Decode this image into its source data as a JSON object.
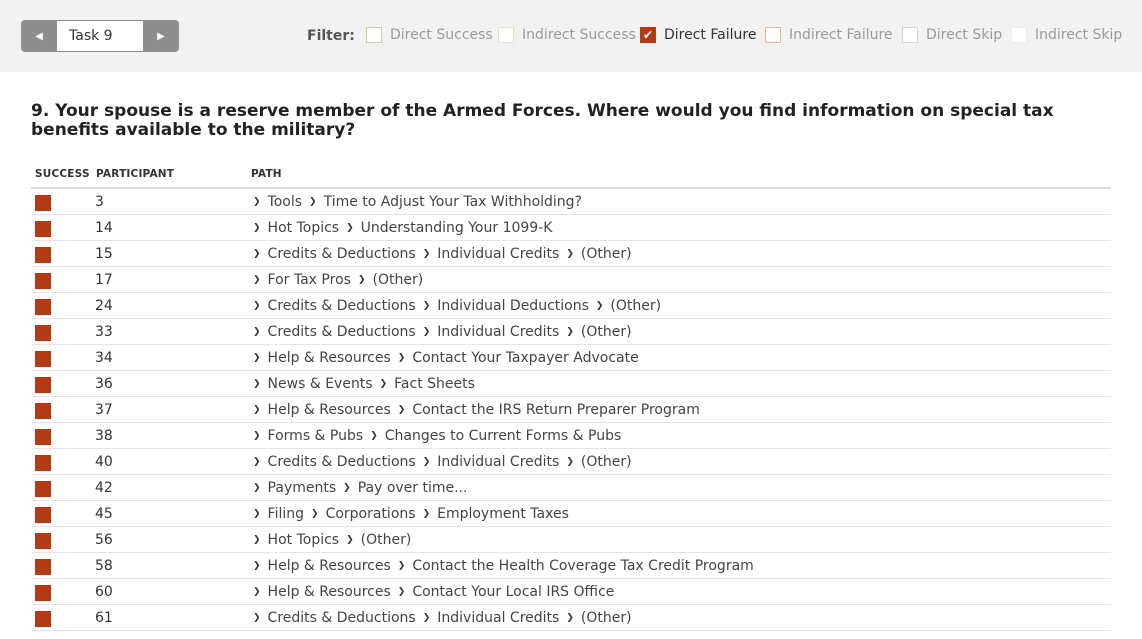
{
  "nav": {
    "task_label": "Task 9",
    "prev_icon": "chevron-left-icon",
    "next_icon": "chevron-right-icon"
  },
  "filter": {
    "label": "Filter:",
    "options": [
      {
        "label": "Direct Success",
        "checked": false,
        "color": "#c9d49a"
      },
      {
        "label": "Indirect Success",
        "checked": false,
        "color": "#e5e5b8"
      },
      {
        "label": "Direct Failure",
        "checked": true,
        "color": "#b33a12"
      },
      {
        "label": "Indirect Failure",
        "checked": false,
        "color": "#e8b79a"
      },
      {
        "label": "Direct Skip",
        "checked": false,
        "color": "#d6d6d6"
      },
      {
        "label": "Indirect Skip",
        "checked": false,
        "color": "#ececec"
      }
    ]
  },
  "question": "9. Your spouse is a reserve member of the Armed Forces. Where would you find information on special tax benefits available to the military?",
  "table": {
    "headers": {
      "success": "SUCCESS",
      "participant": "PARTICIPANT",
      "path": "PATH"
    },
    "status_color": "#b33a12",
    "rows": [
      {
        "participant": "3",
        "path": [
          "Tools",
          "Time to Adjust Your Tax Withholding?"
        ]
      },
      {
        "participant": "14",
        "path": [
          "Hot Topics",
          "Understanding Your 1099-K"
        ]
      },
      {
        "participant": "15",
        "path": [
          "Credits & Deductions",
          "Individual Credits",
          "(Other)"
        ]
      },
      {
        "participant": "17",
        "path": [
          "For Tax Pros",
          "(Other)"
        ]
      },
      {
        "participant": "24",
        "path": [
          "Credits & Deductions",
          "Individual Deductions",
          "(Other)"
        ]
      },
      {
        "participant": "33",
        "path": [
          "Credits & Deductions",
          "Individual Credits",
          "(Other)"
        ]
      },
      {
        "participant": "34",
        "path": [
          "Help & Resources",
          "Contact Your Taxpayer Advocate"
        ]
      },
      {
        "participant": "36",
        "path": [
          "News & Events",
          "Fact Sheets"
        ]
      },
      {
        "participant": "37",
        "path": [
          "Help & Resources",
          "Contact the IRS Return Preparer Program"
        ]
      },
      {
        "participant": "38",
        "path": [
          "Forms & Pubs",
          "Changes to Current Forms & Pubs"
        ]
      },
      {
        "participant": "40",
        "path": [
          "Credits & Deductions",
          "Individual Credits",
          "(Other)"
        ]
      },
      {
        "participant": "42",
        "path": [
          "Payments",
          "Pay over time..."
        ]
      },
      {
        "participant": "45",
        "path": [
          "Filing",
          "Corporations",
          "Employment Taxes"
        ]
      },
      {
        "participant": "56",
        "path": [
          "Hot Topics",
          "(Other)"
        ]
      },
      {
        "participant": "58",
        "path": [
          "Help & Resources",
          "Contact the Health Coverage Tax Credit Program"
        ]
      },
      {
        "participant": "60",
        "path": [
          "Help & Resources",
          "Contact Your Local IRS Office"
        ]
      },
      {
        "participant": "61",
        "path": [
          "Credits & Deductions",
          "Individual Credits",
          "(Other)"
        ]
      }
    ]
  }
}
